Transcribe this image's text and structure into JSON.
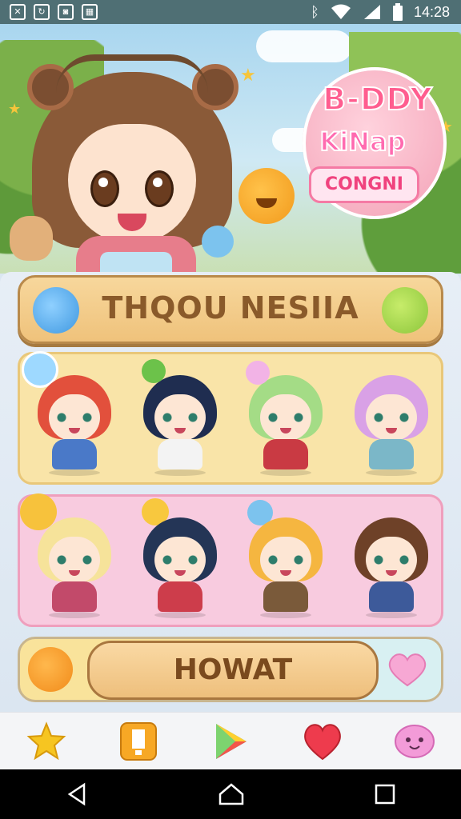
{
  "status_bar": {
    "time": "14:28"
  },
  "logo": {
    "line1": "B-DDY",
    "line2": "KiNap",
    "line3": "CONGNI"
  },
  "title_banner": {
    "label": "THQOU NESIIA"
  },
  "action_banner": {
    "label": "HOWAT"
  },
  "rows": [
    {
      "theme": "yellow",
      "characters": [
        "red-hair-girl",
        "navy-twintail-girl",
        "green-hair-girl",
        "lavender-hair-girl"
      ]
    },
    {
      "theme": "pink",
      "characters": [
        "blonde-girl",
        "dark-hair-girl",
        "orange-hair-boy",
        "brown-twintail-girl"
      ]
    }
  ],
  "bottom_nav": [
    "star-icon",
    "clipboard-icon",
    "play-store-icon",
    "heart-icon",
    "chat-mascot-icon"
  ],
  "colors": {
    "panel": "#e7eef6",
    "banner": "#f7d79c",
    "row1": "#f9e4a8",
    "row2": "#f8cbdf"
  }
}
